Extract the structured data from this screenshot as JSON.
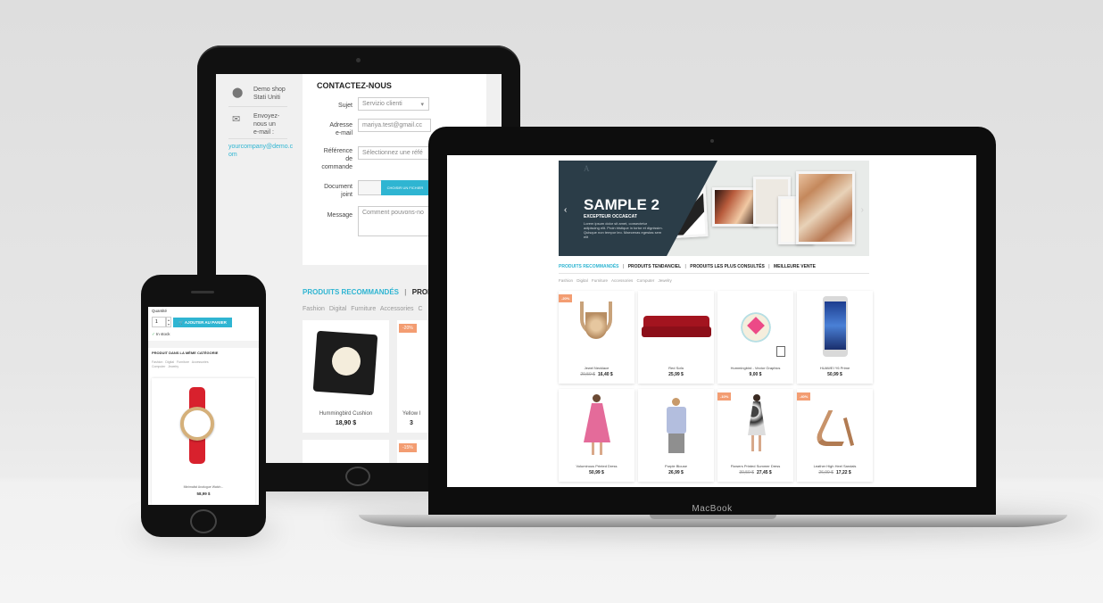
{
  "tablet": {
    "sidebar": {
      "address": "Demo shop\nStati Uniti",
      "email_label": "Envoyez-\nnous un\ne-mail :",
      "email_link": "yourcompany@demo.c\nom"
    },
    "form": {
      "title": "CONTACTEZ-NOUS",
      "subject_label": "Sujet",
      "subject_value": "Servizio clienti",
      "email_label": "Adresse\ne-mail",
      "email_value": "mariya.test@gmail.cc",
      "order_label": "Référence\nde\ncommande",
      "order_value": "Sélectionnez une réfé",
      "attachment_label": "Document\njoint",
      "attachment_button": "CHOISIR UN FICHIER",
      "message_label": "Message",
      "message_placeholder": "Comment pouvons-no"
    },
    "tabs": {
      "active": "PRODUITS RECOMMANDÉS",
      "sep": "|",
      "next": "PRODUITS TE"
    },
    "categories": "Fashion  Digital  Furniture  Accessories  C",
    "products": [
      {
        "name": "Hummingbird Cushion",
        "price": "18,90 $",
        "badge": ""
      },
      {
        "name": "Yellow I",
        "price": "3",
        "badge": "-20%"
      }
    ],
    "bottom_badge": "-15%"
  },
  "laptop": {
    "brand": "MacBook",
    "slider": {
      "logo": "A",
      "title": "SAMPLE 2",
      "subtitle": "EXCEPTEUR OCCAECAT",
      "text": "Lorem ipsum dolor sit amet, consectetur adipiscing elit. Proin tristique in tortor et dignissim. Quisque non tempor leo. Maecenas egestas sem elit",
      "prev": "‹",
      "next": "›"
    },
    "tabs": [
      "PRODUITS RECOMMANDÉS",
      "PRODUITS TENDANCIEL",
      "PRODUITS LES PLUS CONSULTÉS",
      "MEILLEURE VENTE"
    ],
    "tab_sep": "|",
    "categories": "Fashion   Digital   Furniture   Accessories   Computer   Jewelry",
    "products": [
      {
        "name": "Jewel Necklace",
        "old": "20,50 $",
        "price": "16,40 $",
        "badge": "-20%"
      },
      {
        "name": "Red Sofa",
        "old": "",
        "price": "25,99 $",
        "badge": ""
      },
      {
        "name": "Hummingbird - Vector Graphics",
        "old": "",
        "price": "9,00 $",
        "badge": ""
      },
      {
        "name": "HUAWEI Y6 Prime",
        "old": "",
        "price": "50,99 $",
        "badge": ""
      },
      {
        "name": "Voluminous Printed Dress",
        "old": "",
        "price": "50,99 $",
        "badge": ""
      },
      {
        "name": "Purple Blouse",
        "old": "",
        "price": "26,99 $",
        "badge": ""
      },
      {
        "name": "Flowers Printed Summer Dress",
        "old": "30,50 $",
        "price": "27,45 $",
        "badge": "-10%"
      },
      {
        "name": "Leather High Heel Sandals",
        "old": "26,99 $",
        "price": "17,22 $",
        "badge": "-40%"
      }
    ]
  },
  "phone": {
    "quantity_label": "Quantité",
    "quantity_value": "1",
    "add_to_cart": "AJOUTER AU PANIER",
    "stock": "In stock",
    "section_title": "PRODUIT DANS LA MÊME CATÉGORIE",
    "categories": "Fashion   Digital   Furniture   Accessories\nComputer   Jewelry",
    "product_name": "Minimalist Analogue Watch...",
    "product_price": "58,99 $"
  }
}
